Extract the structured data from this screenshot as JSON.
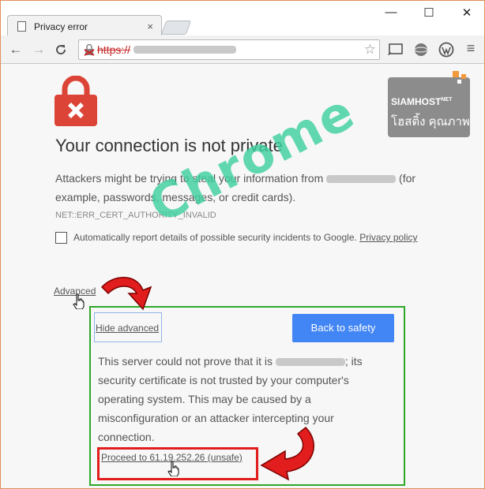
{
  "window": {
    "tab_title": "Privacy error",
    "tab_close": "×",
    "controls": {
      "minimize": "—",
      "maximize": "☐",
      "close": "✕"
    }
  },
  "toolbar": {
    "back_icon": "←",
    "forward_icon": "→",
    "reload_icon": "C",
    "url_scheme": "https://",
    "star_icon": "☆",
    "menu_icon": "≡"
  },
  "logo": {
    "line1": "SIAMHOST",
    "line1_sup": "NET",
    "line2": "โฮสติ้ง คุณภาพ"
  },
  "page": {
    "heading": "Your connection is not private",
    "para_before": "Attackers might be trying to steal your information from ",
    "para_after": " (for example, passwords, messages, or credit cards).",
    "error_code": "NET::ERR_CERT_AUTHORITY_INVALID",
    "report_text": "Automatically report details of possible security incidents to Google. ",
    "privacy_link": "Privacy policy",
    "advanced_link": "Advanced",
    "hide_advanced": "Hide advanced",
    "back_button": "Back to safety",
    "detail_before": "This server could not prove that it is ",
    "detail_after": "; its security certificate is not trusted by your computer's operating system. This may be caused by a misconfiguration or an attacker intercepting your connection.",
    "proceed_link": "Proceed to 61.19.252.26 (unsafe)"
  },
  "watermark": "Chrome",
  "colors": {
    "accent_blue": "#4285f4",
    "lock_red": "#db4437",
    "highlight_green": "#2fa829",
    "highlight_red": "#e11d1d",
    "watermark": "#3fd1a0"
  }
}
